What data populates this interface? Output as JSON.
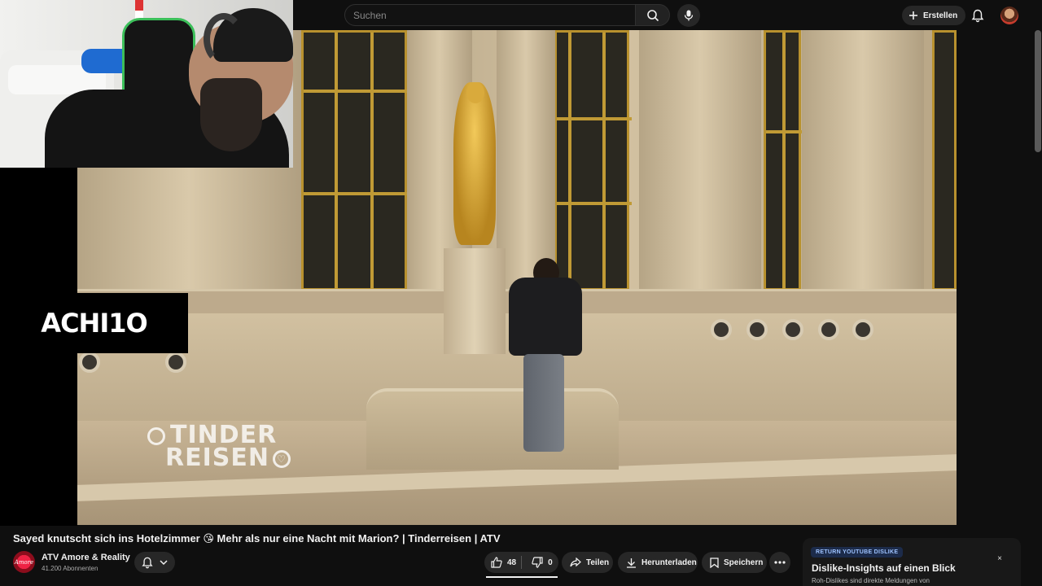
{
  "header": {
    "search_placeholder": "Suchen",
    "create_label": "Erstellen",
    "icons": [
      "search-icon",
      "mic-icon",
      "plus-icon",
      "bell-icon",
      "avatar"
    ]
  },
  "overlay": {
    "brand_text": "ACHI1O",
    "watermark_line1": "TINDER",
    "watermark_line2": "REISEN"
  },
  "video": {
    "title": "Sayed knutscht sich ins Hotelzimmer 😘 Mehr als nur eine Nacht mit Marion? | Tinderreisen | ATV"
  },
  "channel": {
    "name": "ATV Amore & Reality",
    "subscribers": "41.200 Abonnenten",
    "avatar_text": "Amore"
  },
  "actions": {
    "likes": "48",
    "dislikes": "0",
    "share_label": "Teilen",
    "download_label": "Herunterladen",
    "save_label": "Speichern"
  },
  "dislike_card": {
    "badge": "RETURN YOUTUBE DISLIKE",
    "heading": "Dislike-Insights auf einen Blick",
    "description": "Roh-Dislikes sind direkte Meldungen von",
    "close": "×"
  },
  "colors": {
    "background": "#0f0f0f",
    "pill": "#272727",
    "badge_text": "#9ec3ff"
  }
}
